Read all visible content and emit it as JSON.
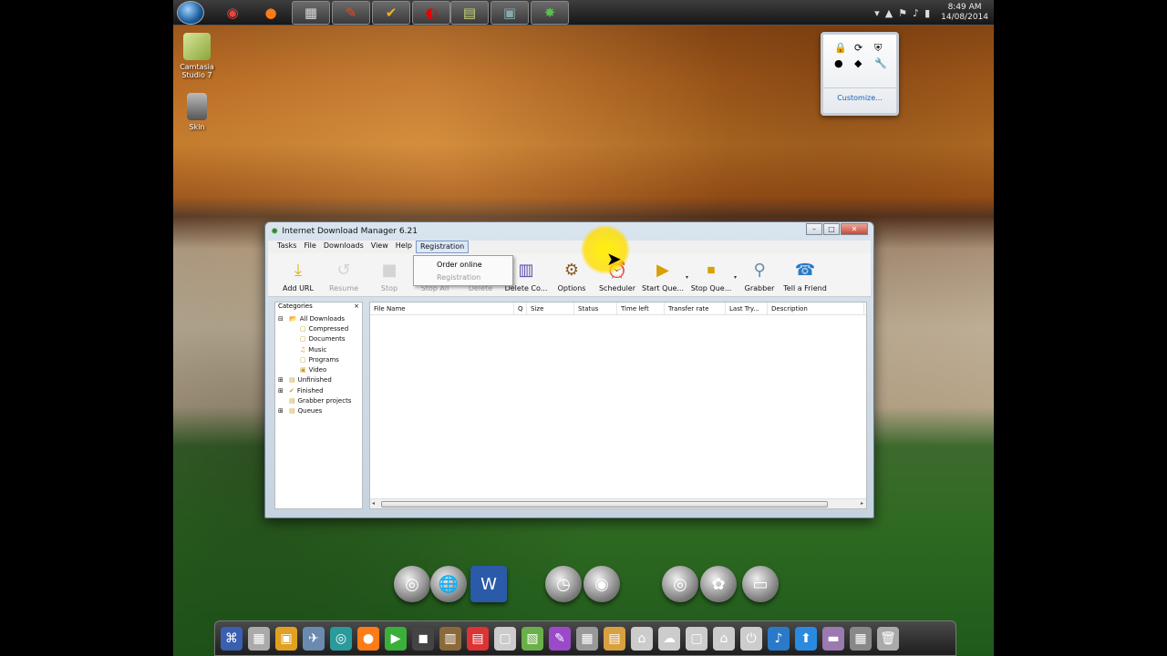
{
  "taskbar": {
    "apps": [
      {
        "name": "chrome",
        "glyph": "◉",
        "color": "#e8453c"
      },
      {
        "name": "firefox",
        "glyph": "●",
        "color": "#ff7b16"
      },
      {
        "name": "store",
        "glyph": "▦",
        "color": "#d9d9d9"
      },
      {
        "name": "ccleaner",
        "glyph": "✎",
        "color": "#e04b2a"
      },
      {
        "name": "antivirus",
        "glyph": "✔",
        "color": "#f2b11c"
      },
      {
        "name": "vodafone",
        "glyph": "◐",
        "color": "#e60000"
      },
      {
        "name": "notes",
        "glyph": "▤",
        "color": "#c7d97a"
      },
      {
        "name": "gadget",
        "glyph": "▣",
        "color": "#8aa"
      },
      {
        "name": "idm",
        "glyph": "✸",
        "color": "#5bbf4e"
      }
    ],
    "clock_time": "8:49 AM",
    "clock_date": "14/08/2014"
  },
  "tray_popup": {
    "icons": [
      "🔒",
      "⟳",
      "⛨",
      "●",
      "◆",
      "🔧"
    ],
    "customize": "Customize..."
  },
  "desktop": {
    "icons": [
      {
        "label1": "Camtasia",
        "label2": "Studio 7"
      },
      {
        "label1": "Skin",
        "label2": ""
      }
    ]
  },
  "window": {
    "title": "Internet Download Manager 6.21",
    "menu": [
      "Tasks",
      "File",
      "Downloads",
      "View",
      "Help",
      "Registration"
    ],
    "registration_menu": [
      "Order online",
      "Registration"
    ],
    "toolbar": [
      {
        "label": "Add URL",
        "icon": "⤓",
        "enabled": true
      },
      {
        "label": "Resume",
        "icon": "↺",
        "enabled": false
      },
      {
        "label": "Stop",
        "icon": "■",
        "enabled": false
      },
      {
        "label": "Stop All",
        "icon": "■",
        "enabled": false
      },
      {
        "label": "Delete",
        "icon": "✕",
        "enabled": false
      },
      {
        "label": "Delete Co...",
        "icon": "▥",
        "enabled": true
      },
      {
        "label": "Options",
        "icon": "⚙",
        "enabled": true
      },
      {
        "label": "Scheduler",
        "icon": "⏰",
        "enabled": true
      },
      {
        "label": "Start Que...",
        "icon": "▶",
        "enabled": true
      },
      {
        "label": "Stop Que...",
        "icon": "⏹",
        "enabled": true
      },
      {
        "label": "Grabber",
        "icon": "⚲",
        "enabled": true
      },
      {
        "label": "Tell a Friend",
        "icon": "☎",
        "enabled": true
      }
    ],
    "categories": {
      "title": "Categories",
      "close": "×",
      "items": [
        {
          "label": "All Downloads",
          "icon": "📂",
          "indent": 1,
          "expander": "⊟"
        },
        {
          "label": "Compressed",
          "icon": "▢",
          "indent": 2,
          "expander": ""
        },
        {
          "label": "Documents",
          "icon": "▢",
          "indent": 2,
          "expander": ""
        },
        {
          "label": "Music",
          "icon": "♫",
          "indent": 2,
          "expander": ""
        },
        {
          "label": "Programs",
          "icon": "▢",
          "indent": 2,
          "expander": ""
        },
        {
          "label": "Video",
          "icon": "▣",
          "indent": 2,
          "expander": ""
        },
        {
          "label": "Unfinished",
          "icon": "▤",
          "indent": 1,
          "expander": "⊞"
        },
        {
          "label": "Finished",
          "icon": "✔",
          "indent": 1,
          "expander": "⊞"
        },
        {
          "label": "Grabber projects",
          "icon": "▤",
          "indent": 1,
          "expander": ""
        },
        {
          "label": "Queues",
          "icon": "▤",
          "indent": 1,
          "expander": "⊞"
        }
      ]
    },
    "columns": [
      "File Name",
      "Q",
      "Size",
      "Status",
      "Time left",
      "Transfer rate",
      "Last Try...",
      "Description"
    ]
  },
  "widgets": [
    {
      "name": "widget-1",
      "glyph": "◎"
    },
    {
      "name": "widget-2",
      "glyph": "🌐"
    },
    {
      "name": "word",
      "glyph": "W"
    },
    {
      "name": "clock",
      "glyph": "◷"
    },
    {
      "name": "widget-5",
      "glyph": "◉"
    },
    {
      "name": "widget-6",
      "glyph": "◎"
    },
    {
      "name": "widget-7",
      "glyph": "✿"
    },
    {
      "name": "hdd",
      "glyph": "▭"
    }
  ],
  "dock": {
    "icons": [
      "⌘",
      "▦",
      "▣",
      "✈",
      "◎",
      "●",
      "▶",
      "◼",
      "▥",
      "▤",
      "▢",
      "▧",
      "✎",
      "▦",
      "▤",
      "⌂",
      "☁",
      "▢",
      "⌂",
      "⏻",
      "♪",
      "⬆",
      "▬",
      "▦",
      "🗑"
    ]
  }
}
